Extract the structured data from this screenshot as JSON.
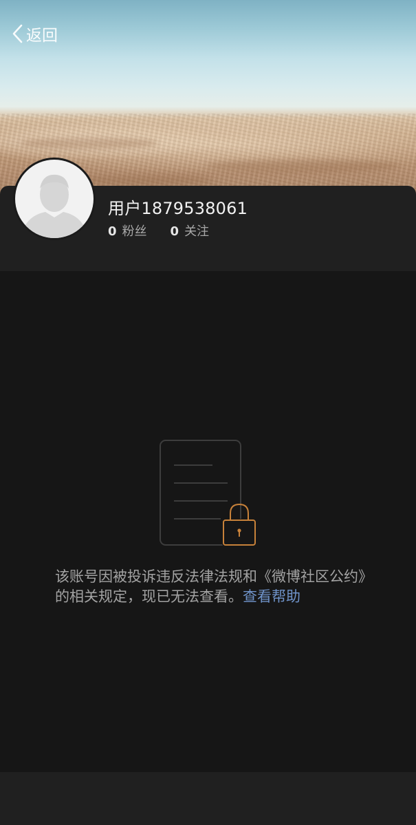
{
  "nav": {
    "back_label": "返回"
  },
  "profile": {
    "username": "用户1879538061",
    "followers_count": "0",
    "followers_label": "粉丝",
    "following_count": "0",
    "following_label": "关注"
  },
  "notice": {
    "message": "该账号因被投诉违反法律法规和《微博社区公约》的相关规定，现已无法查看。",
    "help_link": "查看帮助"
  },
  "icons": {
    "back": "chevron-left-icon",
    "avatar": "default-avatar-icon",
    "locked_document": "locked-document-icon"
  },
  "colors": {
    "background": "#161616",
    "card": "#202020",
    "link": "#6f93c9",
    "lock_accent": "#c8823a"
  }
}
